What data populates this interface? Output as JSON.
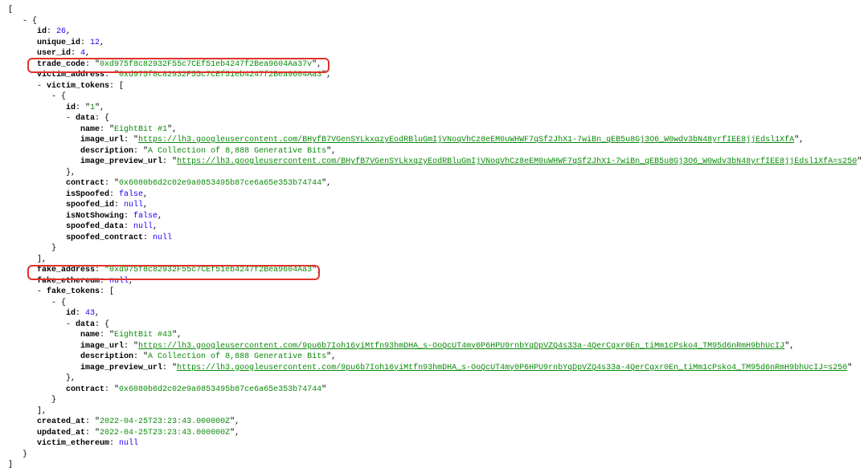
{
  "root": {
    "id": 26,
    "unique_id": 12,
    "user_id": 4,
    "trade_code": "0xd975f8c82932F55c7CEf51eb4247f2Bea9604Aa37v",
    "victim_address": "0xd975f8c82932F55c7CEf51eb4247f2Bea9604Aa3",
    "victim_tokens": [
      {
        "id": "1",
        "data": {
          "name": "EightBit #1",
          "image_url": "https://lh3.googleusercontent.com/BHyfB7VGenSYLkxqzyEodRBluGmIjVNoqVhCz8eEM0uWHWF7qSf2JhX1-7wiBn_qEB5u8Gj3O6_W0wdv3bN48yrfIEE8jjEdsl1XfA",
          "description": "A Collection of 8,888 Generative Bits",
          "image_preview_url": "https://lh3.googleusercontent.com/BHyfB7VGenSYLkxqzyEodRBluGmIjVNoqVhCz8eEM0uWHWF7qSf2JhX1-7wiBn_qEB5u8Gj3O6_W0wdv3bN48yrfIEE8jjEdsl1XfA=s250"
        },
        "contract": "0x6080b6d2c02e9a0853495b87ce6a65e353b74744",
        "isSpoofed": false,
        "spoofed_id": null,
        "isNotShowing": false,
        "spoofed_data": null,
        "spoofed_contract": null
      }
    ],
    "fake_address": "0xd975f8c82932F55c7CEf51eb4247f2Bea9604Aa3",
    "fake_ethereum": null,
    "fake_tokens": [
      {
        "id": 43,
        "data": {
          "name": "EightBit #43",
          "image_url": "https://lh3.googleusercontent.com/9pu6b7Ioh16yiMtfn93hmDHA_s-OoQcUT4my0P6HPU9rnbYqDpVZQ4s33a-4QerCgxr0En_tiMm1cPsko4_TM95d6nRmH9bhUcIJ",
          "description": "A Collection of 8,888 Generative Bits",
          "image_preview_url": "https://lh3.googleusercontent.com/9pu6b7Ioh16yiMtfn93hmDHA_s-OoQcUT4my0P6HPU9rnbYqDpVZQ4s33a-4QerCgxr0En_tiMm1cPsko4_TM95d6nRmH9bhUcIJ=s250"
        },
        "contract": "0x6080b6d2c02e9a0853495b87ce6a65e353b74744"
      }
    ],
    "created_at": "2022-04-25T23:23:43.000000Z",
    "updated_at": "2022-04-25T23:23:43.000000Z",
    "victim_ethereum": null
  }
}
